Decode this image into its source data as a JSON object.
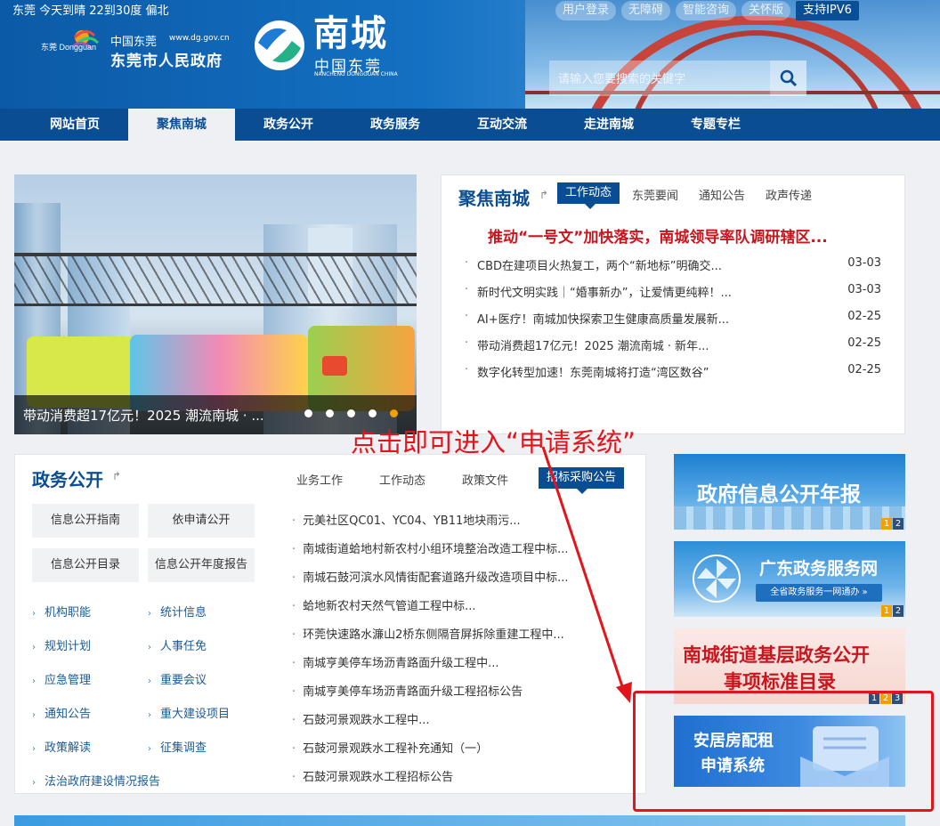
{
  "header": {
    "weather": "东莞  今天到晴 22到30度 偏北",
    "top_links": [
      "用户登录",
      "无障碍",
      "智能咨询",
      "关怀版",
      "支持IPV6"
    ],
    "logo_cn_script": "中国东莞",
    "logo_url": "www.dg.gov.cn",
    "logo_gov_name": "东莞市人民政府",
    "logo_emblem_text": "东莞 Dongguan",
    "nancheng_title": "南城",
    "nancheng_sub": "中国东莞",
    "nancheng_en": "NANCHENG DONGGUAN CHINA",
    "search_placeholder": "请输入您要搜索的关键字"
  },
  "nav": {
    "items": [
      "网站首页",
      "聚焦南城",
      "政务公开",
      "政务服务",
      "互动交流",
      "走进南城",
      "专题专栏"
    ],
    "active_index": 1
  },
  "banner": {
    "caption": "带动消费超17亿元！2025 潮流南城 · ...",
    "slide_count": 5,
    "active_slide": 5
  },
  "focus": {
    "title": "聚焦南城",
    "tabs": [
      "工作动态",
      "东莞要闻",
      "通知公告",
      "政声传递"
    ],
    "active_tab": 0,
    "headline": "推动“一号文”加快落实，南城领导率队调研辖区...",
    "news": [
      {
        "title": "CBD在建项目火热复工，两个“新地标”明确交...",
        "date": "03-03"
      },
      {
        "title": "新时代文明实践｜“婚事新办”，让爱情更纯粹！...",
        "date": "03-03"
      },
      {
        "title": "AI+医疗！南城加快探索卫生健康高质量发展新...",
        "date": "02-25"
      },
      {
        "title": "带动消费超17亿元！2025 潮流南城 · 新年...",
        "date": "02-25"
      },
      {
        "title": "数字化转型加速！东莞南城将打造“湾区数谷”",
        "date": "02-25"
      }
    ]
  },
  "gov": {
    "title": "政务公开",
    "tabs": [
      "业务工作",
      "工作动态",
      "政策文件",
      "招标采购公告"
    ],
    "active_tab": 3,
    "buttons": [
      "信息公开指南",
      "依申请公开",
      "信息公开目录",
      "信息公开年度报告"
    ],
    "links_left": [
      "机构职能",
      "规划计划",
      "应急管理",
      "通知公告",
      "政策解读",
      "法治政府建设情况报告"
    ],
    "links_right": [
      "统计信息",
      "人事任免",
      "重要会议",
      "重大建设项目",
      "征集调查"
    ],
    "list": [
      "元美社区QC01、YC04、YB11地块雨污...",
      "南城街道蛤地村新农村小组环境整治改造工程中标...",
      "南城石鼓河滨水风情街配套道路升级改造项目中标...",
      "蛤地新农村天然气管道工程中标...",
      "环莞快速路水濂山2桥东侧隔音屏拆除重建工程中...",
      "南城亨美停车场沥青路面升级工程中...",
      "南城亨美停车场沥青路面升级工程招标公告",
      "石鼓河景观跌水工程中...",
      "石鼓河景观跌水工程补充通知（一）",
      "石鼓河景观跌水工程招标公告"
    ]
  },
  "promos": {
    "p1_title": "政府信息公开年报",
    "p1_pages": [
      "1",
      "2"
    ],
    "p2_title": "广东政务服务网",
    "p2_sub": "全省政务服务一网通办 »",
    "p2_pages": [
      "1",
      "2"
    ],
    "p3_title_line1": "南城街道基层政务公开",
    "p3_title_line2": "事项标准目录",
    "p3_pages": [
      "1",
      "2",
      "3"
    ],
    "p4_line1": "安居房配租",
    "p4_line2": "申请系统"
  },
  "annotation": {
    "text": "点击即可进入“申请系统”",
    "color": "#e2141c"
  },
  "colors": {
    "primary": "#0b4d92",
    "headline_red": "#c9151e",
    "accent_orange": "#f0a000"
  }
}
